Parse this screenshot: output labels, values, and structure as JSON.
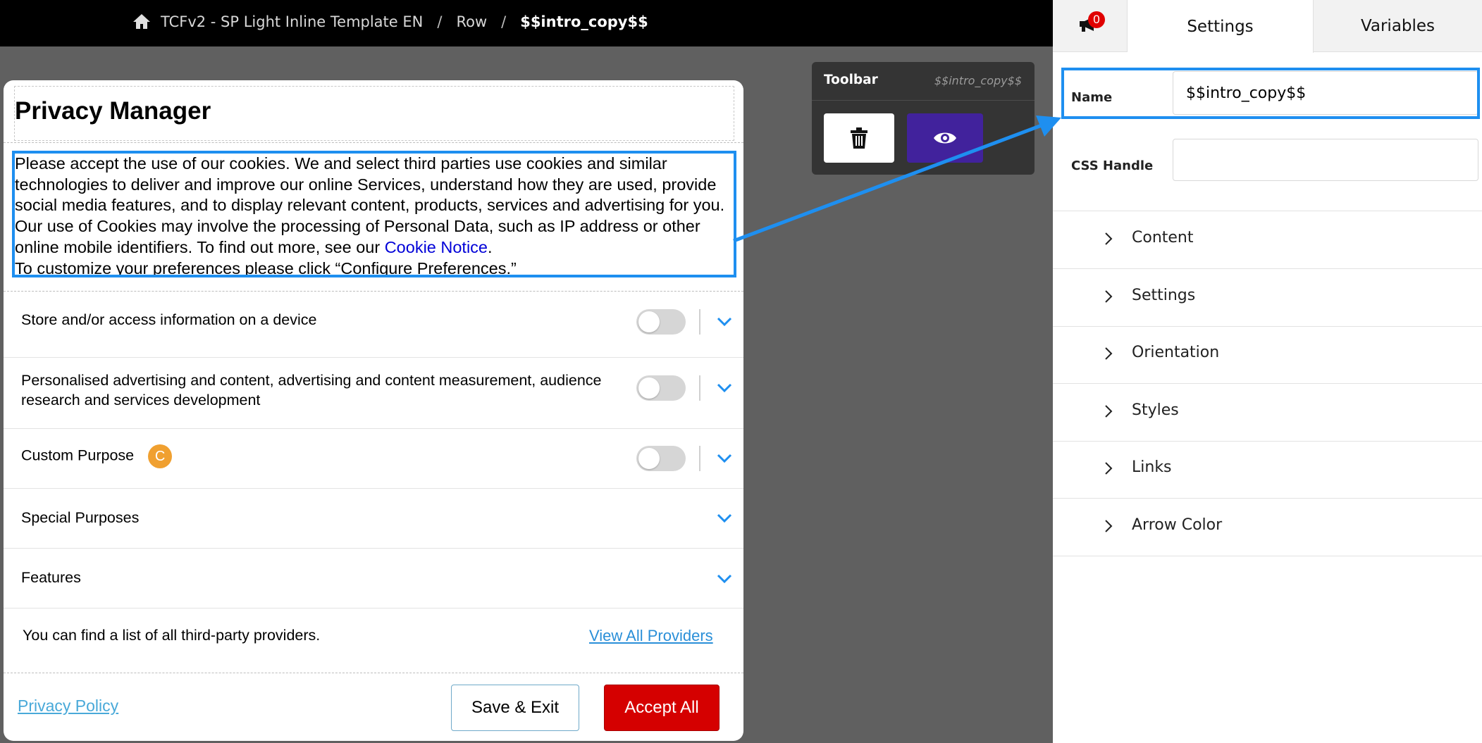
{
  "breadcrumb": {
    "items": [
      "TCFv2 - SP Light Inline Template EN",
      "Row",
      "$$intro_copy$$"
    ],
    "separator": "/"
  },
  "privacy_manager": {
    "title": "Privacy Manager",
    "intro_text": "Please accept the use of our cookies. We and select third parties use cookies and similar technologies to deliver and improve our online Services, understand how they are used, provide social media features, and to display relevant content, products, services and advertising for you. Our use of Cookies may involve the processing of Personal Data, such as IP address or other online mobile identifiers. To find out more, see our ",
    "cookie_link": "Cookie Notice",
    "intro_end": ".",
    "intro_text_2": "To customize your preferences please click “Configure Preferences.”",
    "purposes": [
      {
        "label": "Store and/or access information on a device",
        "has_toggle": true
      },
      {
        "label": "Personalised advertising and content, advertising and content measurement, audience research and services development",
        "has_toggle": true
      },
      {
        "label": "Custom Purpose",
        "badge": "C",
        "has_toggle": true
      },
      {
        "label": "Special Purposes",
        "has_toggle": false
      },
      {
        "label": "Features",
        "has_toggle": false
      }
    ],
    "providers_text": "You can find a list of all third-party providers.",
    "providers_link": "View All Providers",
    "privacy_policy_link": "Privacy Policy",
    "save_exit_label": "Save & Exit",
    "accept_all_label": "Accept All"
  },
  "toolbar": {
    "title": "Toolbar",
    "element_name": "$$intro_copy$$"
  },
  "panel": {
    "notification_count": "0",
    "tabs": [
      "Settings",
      "Variables"
    ],
    "active_tab": "Settings",
    "name_label": "Name",
    "name_value": "$$intro_copy$$",
    "css_handle_label": "CSS Handle",
    "css_handle_value": "",
    "sections": [
      "Content",
      "Settings",
      "Orientation",
      "Styles",
      "Links",
      "Arrow Color"
    ]
  },
  "colors": {
    "selection": "#1e8ff0",
    "accept_button": "#d50000",
    "preview_button": "#41229c",
    "link": "#0000d8",
    "badge": "#f0a030"
  }
}
